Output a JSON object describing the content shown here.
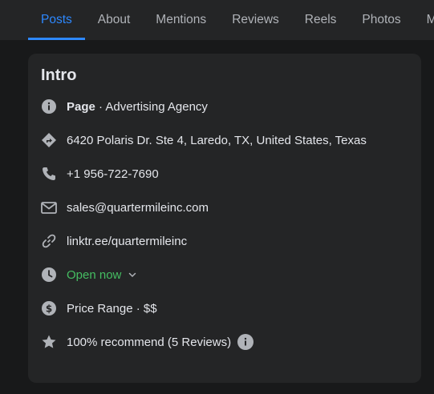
{
  "tabs": [
    {
      "label": "Posts",
      "active": true
    },
    {
      "label": "About",
      "active": false
    },
    {
      "label": "Mentions",
      "active": false
    },
    {
      "label": "Reviews",
      "active": false
    },
    {
      "label": "Reels",
      "active": false
    },
    {
      "label": "Photos",
      "active": false
    },
    {
      "label": "Mo",
      "active": false
    }
  ],
  "intro": {
    "title": "Intro",
    "page_label": "Page",
    "category": " · Advertising Agency",
    "address": "6420 Polaris Dr. Ste 4, Laredo, TX, United States, Texas",
    "phone": "+1 956-722-7690",
    "email": "sales@quartermileinc.com",
    "website": "linktr.ee/quartermileinc",
    "hours_status": "Open now",
    "price_range": "Price Range · $$",
    "recommend": "100% recommend (5 Reviews)"
  },
  "colors": {
    "background": "#18191a",
    "card": "#242526",
    "accent": "#2d88ff",
    "open_green": "#45bd62",
    "icon_gray": "#b0b3b8",
    "text": "#e4e6eb"
  },
  "icons": [
    "info-icon",
    "directions-icon",
    "phone-icon",
    "mail-icon",
    "link-icon",
    "clock-icon",
    "dollar-icon",
    "star-icon",
    "chevron-down-icon"
  ]
}
